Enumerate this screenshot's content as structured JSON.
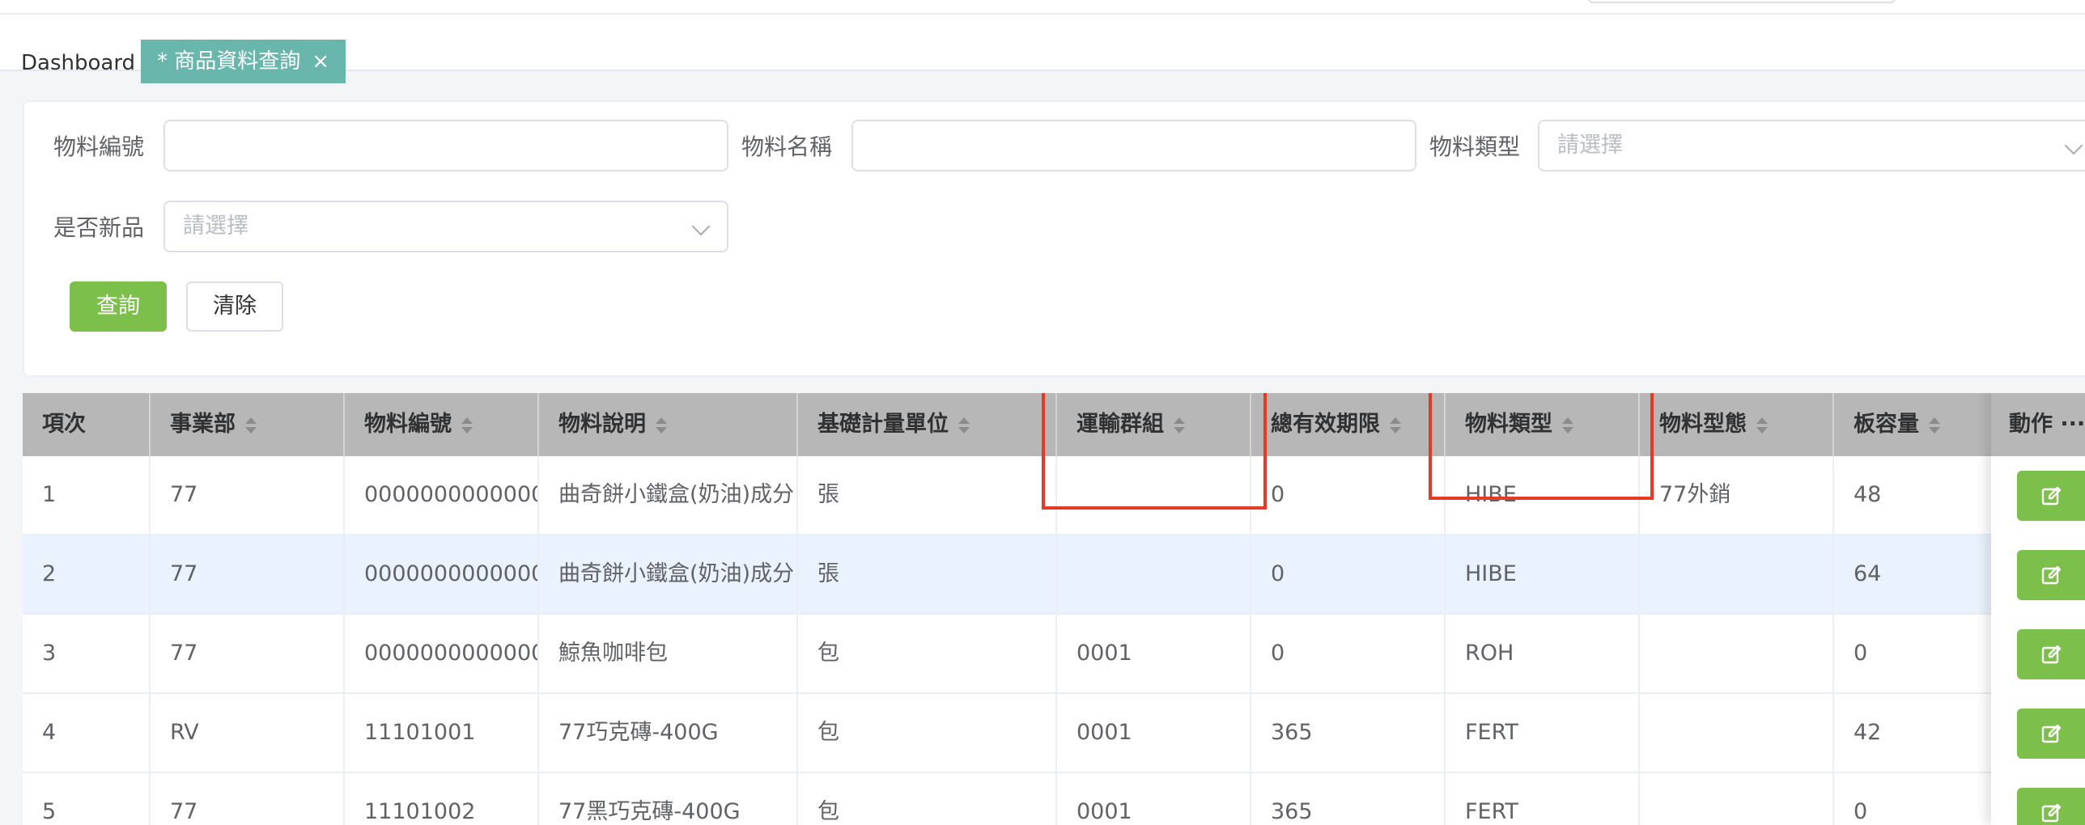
{
  "tags": {
    "dashboard": "Dashboard",
    "active": "* 商品資料查詢",
    "close_icon": "×"
  },
  "filters": {
    "material_no_label": "物料編號",
    "material_name_label": "物料名稱",
    "material_type_label": "物料類型",
    "material_type_placeholder": "請選擇",
    "is_new_label": "是否新品",
    "is_new_placeholder": "請選擇",
    "search_button": "查詢",
    "clear_button": "清除"
  },
  "table": {
    "columns": [
      "項次",
      "事業部",
      "物料編號",
      "物料說明",
      "基礎計量單位",
      "運輸群組",
      "總有效期限",
      "物料類型",
      "物料型態",
      "板容量"
    ],
    "action_header": "動作 ···",
    "rows": [
      [
        "1",
        "77",
        "0000000000000",
        "曲奇餅小鐵盒(奶油)成分",
        "張",
        "",
        "0",
        "HIBE",
        "77外銷",
        "48"
      ],
      [
        "2",
        "77",
        "0000000000000",
        "曲奇餅小鐵盒(奶油)成分",
        "張",
        "",
        "0",
        "HIBE",
        "",
        "64"
      ],
      [
        "3",
        "77",
        "0000000000000",
        "鯨魚咖啡包",
        "包",
        "0001",
        "0",
        "ROH",
        "",
        "0"
      ],
      [
        "4",
        "RV",
        "11101001",
        "77巧克磚-400G",
        "包",
        "0001",
        "365",
        "FERT",
        "",
        "42"
      ],
      [
        "5",
        "77",
        "11101002",
        "77黑巧克磚-400G",
        "包",
        "0001",
        "365",
        "FERT",
        "",
        "0"
      ]
    ]
  },
  "colors": {
    "primary_green": "#7cc04b",
    "active_tag": "#69b6ac",
    "highlight_box": "#e53a26",
    "header_bg": "#b7b7b7"
  },
  "icons": {
    "row_action": "edit-icon",
    "select_arrow": "chevron-down-icon",
    "sort": "sort-icon"
  }
}
